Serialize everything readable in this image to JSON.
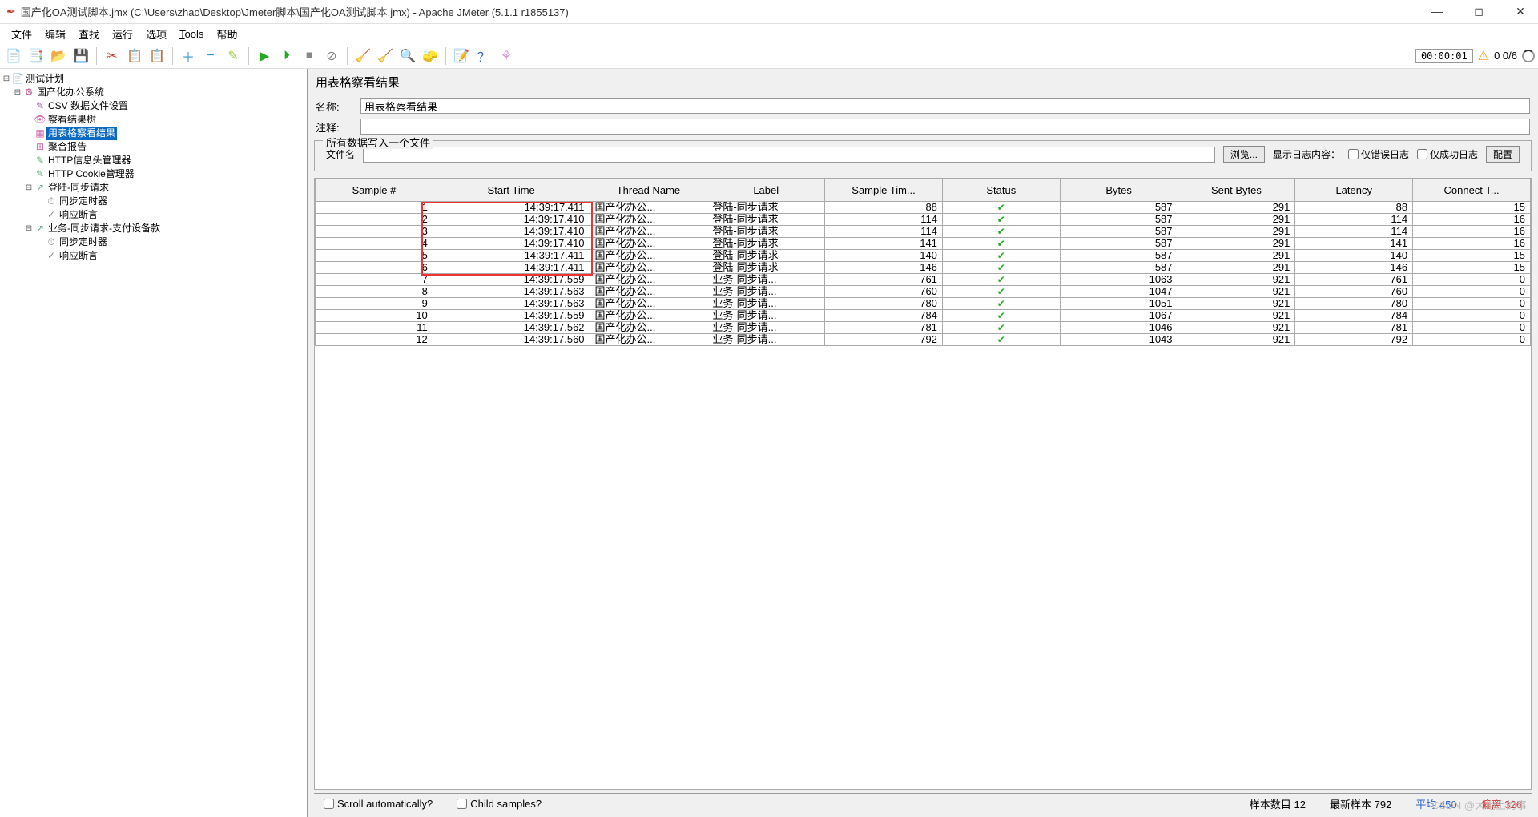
{
  "window": {
    "title": "国产化OA测试脚本.jmx (C:\\Users\\zhao\\Desktop\\Jmeter脚本\\国产化OA测试脚本.jmx) - Apache JMeter (5.1.1 r1855137)"
  },
  "menu": [
    "文件",
    "编辑",
    "查找",
    "运行",
    "选项",
    "Tools",
    "帮助"
  ],
  "toolbar_right": {
    "timer": "00:00:01",
    "counts": "0  0/6"
  },
  "tree": [
    {
      "indent": 0,
      "toggle": "⊟",
      "icon": "📄",
      "cls": "ico-plan",
      "label": "测试计划",
      "sel": false
    },
    {
      "indent": 1,
      "toggle": "⊟",
      "icon": "⚙",
      "cls": "ico-tg",
      "label": "国产化办公系统",
      "sel": false
    },
    {
      "indent": 2,
      "toggle": "",
      "icon": "✎",
      "cls": "ico-cfg",
      "label": "CSV 数据文件设置",
      "sel": false
    },
    {
      "indent": 2,
      "toggle": "",
      "icon": "👁",
      "cls": "ico-view",
      "label": "察看结果树",
      "sel": false
    },
    {
      "indent": 2,
      "toggle": "",
      "icon": "▦",
      "cls": "ico-view",
      "label": "用表格察看结果",
      "sel": true
    },
    {
      "indent": 2,
      "toggle": "",
      "icon": "⊞",
      "cls": "ico-view",
      "label": "聚合报告",
      "sel": false
    },
    {
      "indent": 2,
      "toggle": "",
      "icon": "✎",
      "cls": "ico-hdr",
      "label": "HTTP信息头管理器",
      "sel": false
    },
    {
      "indent": 2,
      "toggle": "",
      "icon": "✎",
      "cls": "ico-cook",
      "label": "HTTP Cookie管理器",
      "sel": false
    },
    {
      "indent": 2,
      "toggle": "⊟",
      "icon": "↗",
      "cls": "ico-req",
      "label": "登陆-同步请求",
      "sel": false
    },
    {
      "indent": 3,
      "toggle": "",
      "icon": "⏱",
      "cls": "ico-timer",
      "label": "同步定时器",
      "sel": false
    },
    {
      "indent": 3,
      "toggle": "",
      "icon": "✓",
      "cls": "ico-assert",
      "label": "响应断言",
      "sel": false
    },
    {
      "indent": 2,
      "toggle": "⊟",
      "icon": "↗",
      "cls": "ico-req",
      "label": "业务-同步请求-支付设备款",
      "sel": false
    },
    {
      "indent": 3,
      "toggle": "",
      "icon": "⏱",
      "cls": "ico-timer",
      "label": "同步定时器",
      "sel": false
    },
    {
      "indent": 3,
      "toggle": "",
      "icon": "✓",
      "cls": "ico-assert",
      "label": "响应断言",
      "sel": false
    }
  ],
  "panel": {
    "title": "用表格察看结果",
    "name_label": "名称:",
    "name_value": "用表格察看结果",
    "comment_label": "注释:",
    "comment_value": "",
    "file_group": "所有数据写入一个文件",
    "filename_label": "文件名",
    "browse": "浏览...",
    "log_label": "显示日志内容：",
    "only_err": "仅错误日志",
    "only_ok": "仅成功日志",
    "config": "配置"
  },
  "table": {
    "headers": [
      "Sample #",
      "Start Time",
      "Thread Name",
      "Label",
      "Sample Tim...",
      "Status",
      "Bytes",
      "Sent Bytes",
      "Latency",
      "Connect T..."
    ],
    "rows": [
      {
        "n": 1,
        "t": "14:39:17.411",
        "th": "国产化办公...",
        "lb": "登陆-同步请求",
        "st": 88,
        "by": 587,
        "sb": 291,
        "la": 88,
        "ct": 15
      },
      {
        "n": 2,
        "t": "14:39:17.410",
        "th": "国产化办公...",
        "lb": "登陆-同步请求",
        "st": 114,
        "by": 587,
        "sb": 291,
        "la": 114,
        "ct": 16
      },
      {
        "n": 3,
        "t": "14:39:17.410",
        "th": "国产化办公...",
        "lb": "登陆-同步请求",
        "st": 114,
        "by": 587,
        "sb": 291,
        "la": 114,
        "ct": 16
      },
      {
        "n": 4,
        "t": "14:39:17.410",
        "th": "国产化办公...",
        "lb": "登陆-同步请求",
        "st": 141,
        "by": 587,
        "sb": 291,
        "la": 141,
        "ct": 16
      },
      {
        "n": 5,
        "t": "14:39:17.411",
        "th": "国产化办公...",
        "lb": "登陆-同步请求",
        "st": 140,
        "by": 587,
        "sb": 291,
        "la": 140,
        "ct": 15
      },
      {
        "n": 6,
        "t": "14:39:17.411",
        "th": "国产化办公...",
        "lb": "登陆-同步请求",
        "st": 146,
        "by": 587,
        "sb": 291,
        "la": 146,
        "ct": 15
      },
      {
        "n": 7,
        "t": "14:39:17.559",
        "th": "国产化办公...",
        "lb": "业务-同步请...",
        "st": 761,
        "by": 1063,
        "sb": 921,
        "la": 761,
        "ct": 0
      },
      {
        "n": 8,
        "t": "14:39:17.563",
        "th": "国产化办公...",
        "lb": "业务-同步请...",
        "st": 760,
        "by": 1047,
        "sb": 921,
        "la": 760,
        "ct": 0
      },
      {
        "n": 9,
        "t": "14:39:17.563",
        "th": "国产化办公...",
        "lb": "业务-同步请...",
        "st": 780,
        "by": 1051,
        "sb": 921,
        "la": 780,
        "ct": 0
      },
      {
        "n": 10,
        "t": "14:39:17.559",
        "th": "国产化办公...",
        "lb": "业务-同步请...",
        "st": 784,
        "by": 1067,
        "sb": 921,
        "la": 784,
        "ct": 0
      },
      {
        "n": 11,
        "t": "14:39:17.562",
        "th": "国产化办公...",
        "lb": "业务-同步请...",
        "st": 781,
        "by": 1046,
        "sb": 921,
        "la": 781,
        "ct": 0
      },
      {
        "n": 12,
        "t": "14:39:17.560",
        "th": "国产化办公...",
        "lb": "业务-同步请...",
        "st": 792,
        "by": 1043,
        "sb": 921,
        "la": 792,
        "ct": 0
      }
    ]
  },
  "statusbar": {
    "scroll": "Scroll automatically?",
    "child": "Child samples?",
    "samples": "样本数目 12",
    "latest": "最新样本 792",
    "avg_lbl": "平均",
    "avg_val": "450",
    "dev_lbl": "偏离",
    "dev_val": "326"
  },
  "watermark": "CSDN @大地上的事"
}
